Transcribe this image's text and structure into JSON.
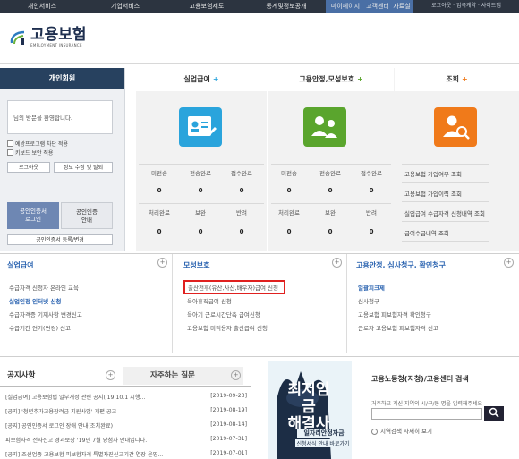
{
  "nav": {
    "items": [
      "개인서비스",
      "기업서비스",
      "고용보험제도",
      "통계및정보공개",
      "마이페이지",
      "고객센터",
      "자료실"
    ],
    "right": "로그아웃 · 임극계약 · 사이트맵"
  },
  "header": {
    "logo_main": "고용보험",
    "logo_sub": "EMPLOYMENT INSURANCE"
  },
  "member": {
    "title": "개인회원",
    "welcome": "님의 방문을 환영합니다.",
    "check1": "예방프로그램 차단 적용",
    "check2": "키보드 보안 적용",
    "logout": "로그아웃",
    "edit": "정보 수정 및 탈퇴",
    "cert_login_1": "공인인증서",
    "cert_login_2": "로그인",
    "cert_guide_1": "공인인증",
    "cert_guide_2": "안내",
    "cert_register": "공인인증서 등록/변경"
  },
  "categories": {
    "unemployment": {
      "title": "실업급여",
      "plus": "+",
      "stats_top": [
        "미전송",
        "전송완료",
        "접수완료"
      ],
      "stats_bottom": [
        "처리완료",
        "보완",
        "반려"
      ],
      "values_top": [
        "0",
        "0",
        "0"
      ],
      "values_bottom": [
        "0",
        "0",
        "0"
      ]
    },
    "maternity": {
      "title": "고용안정,모성보호",
      "plus": "+",
      "stats_top": [
        "미전송",
        "전송완료",
        "접수완료"
      ],
      "stats_bottom": [
        "처리완료",
        "보완",
        "반려"
      ],
      "values_top": [
        "0",
        "0",
        "0"
      ],
      "values_bottom": [
        "0",
        "0",
        "0"
      ]
    },
    "lookup": {
      "title": "조회",
      "plus": "+",
      "items": [
        "고용보험 가입여부 조회",
        "고용보험 가입이력 조회",
        "실업급여 수급자격 신청내역 조회",
        "급여수급내역 조회"
      ]
    }
  },
  "services": {
    "unemployment": {
      "title": "실업급여",
      "items": [
        "수급자격 신청자 온라인 교육",
        "실업인정 인터넷 신청",
        "수급자격증 기재사항 변경신고",
        "수급기간 연기(변경) 신고"
      ]
    },
    "maternity": {
      "title": "모성보호",
      "items": [
        "출산전후(유산,사산,배우자)급여 신청",
        "육아휴직급여 신청",
        "육아기 근로시간단축 급여신청",
        "고용보험 미적용자 출산급여 신청"
      ]
    },
    "appeal": {
      "title": "고용안정, 심사청구, 확인청구",
      "items": [
        "일괄피크제",
        "심사청구",
        "고용보험 피보험자격 확인청구",
        "근로자 고용보험 피보험자격 신고"
      ]
    }
  },
  "notices": {
    "tab_notice": "공지사항",
    "tab_faq": "자주하는 질문",
    "items": [
      {
        "text": "[실업급여] 고용보험법 일부개정 관련 공지('19.10.1 시행...",
        "date": "[2019-09-23]"
      },
      {
        "text": "[공지] '청년추가고용장려금 지원사업' 개편 공고",
        "date": "[2019-08-19]"
      },
      {
        "text": "[공지] 공인인증서 로그인 장애 안내(조치완료)",
        "date": "[2019-08-14]"
      },
      {
        "text": "피보험자격 전자신고 경과보상 '19년 7월 당첨자 안내입니다.",
        "date": "[2019-07-31]"
      },
      {
        "text": "[공지] 조선업종 고용보험 피보험자격 특별자진신고기간 연장 운영...",
        "date": "[2019-07-01]"
      }
    ]
  },
  "banner": {
    "line1": "최저임금",
    "line2": "해결사",
    "line3": "일자리안정자금",
    "line4": "신청서식 안내 바로가기"
  },
  "search": {
    "title": "고용노동청(지청)/고용센터 검색",
    "hint": "거주하고 계신 지역의 시/구/동 명을 입력해주세요",
    "link": "지역검색 자세히 보기"
  },
  "colors": {
    "nav_bg": "#2c3440",
    "accent_blue": "#2a63b0",
    "highlight_red": "#e0201f",
    "green": "#5aa52d",
    "orange": "#f07a1a",
    "teal_blue": "#2aa4dc"
  }
}
